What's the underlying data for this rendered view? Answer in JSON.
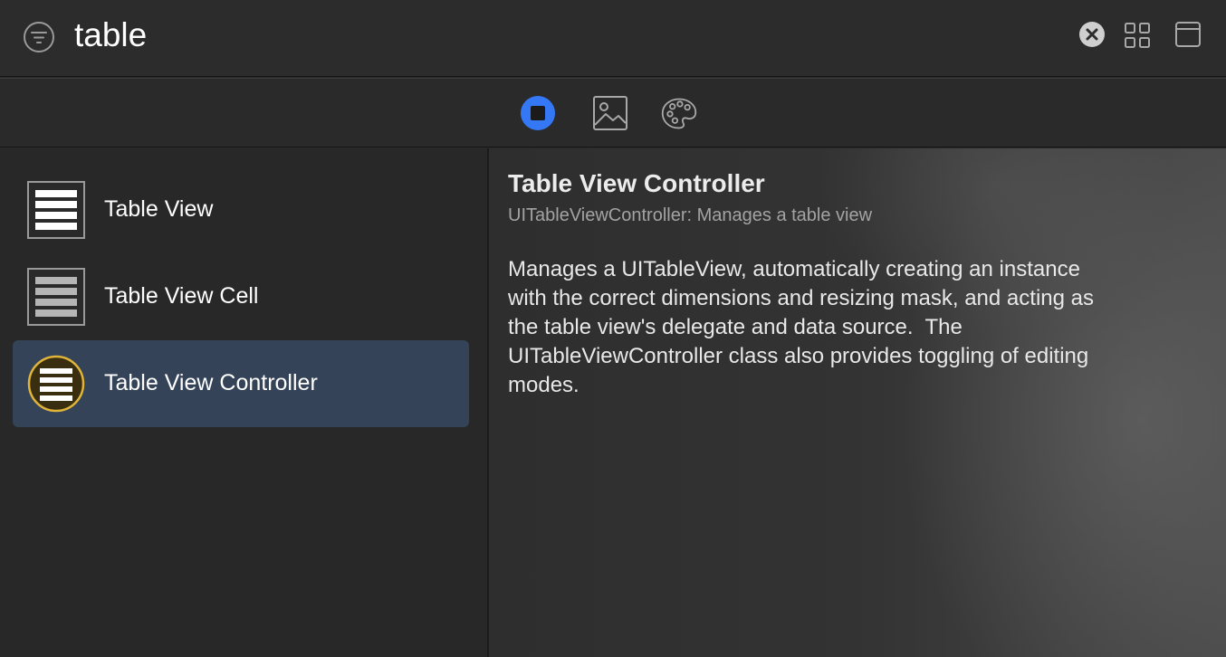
{
  "search": {
    "value": "table",
    "placeholder": "Filter"
  },
  "toolbar": {
    "filter_icon": "filter-icon",
    "clear_icon": "clear-icon",
    "grid_icon": "grid-view-icon",
    "window_icon": "window-icon"
  },
  "tabs": [
    {
      "name": "objects",
      "icon": "objects-icon",
      "selected": true
    },
    {
      "name": "media",
      "icon": "image-icon",
      "selected": false
    },
    {
      "name": "colors",
      "icon": "palette-icon",
      "selected": false
    }
  ],
  "objects": {
    "items": [
      {
        "label": "Table View",
        "icon": "table-view-icon",
        "selected": false
      },
      {
        "label": "Table View Cell",
        "icon": "table-view-cell-icon",
        "selected": false
      },
      {
        "label": "Table View Controller",
        "icon": "table-view-controller-icon",
        "selected": true
      }
    ]
  },
  "detail": {
    "title": "Table View Controller",
    "subtitle": "UITableViewController: Manages a table view",
    "description": "Manages a UITableView, automatically creating an instance\nwith the correct dimensions and resizing mask, and acting as\nthe table view's delegate and data source.  The\nUITableViewController class also provides toggling of editing\nmodes."
  },
  "colors": {
    "accent": "#3478f6",
    "selection": "#344357",
    "controller_icon_ring": "#e0b43a"
  }
}
